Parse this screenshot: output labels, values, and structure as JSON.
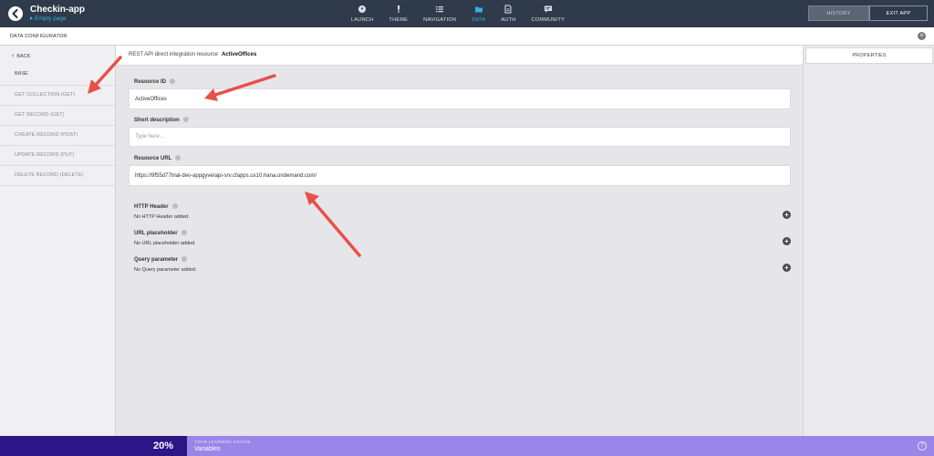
{
  "app": {
    "title": "Checkin-app",
    "subtitle": "Empty page"
  },
  "nav": {
    "items": [
      {
        "label": "LAUNCH",
        "icon": "rocket-icon"
      },
      {
        "label": "THEME",
        "icon": "brush-icon"
      },
      {
        "label": "NAVIGATION",
        "icon": "list-icon"
      },
      {
        "label": "DATA",
        "icon": "folder-icon",
        "active": true
      },
      {
        "label": "AUTH",
        "icon": "document-icon"
      },
      {
        "label": "COMMUNITY",
        "icon": "chat-icon"
      }
    ]
  },
  "header_buttons": {
    "history": "HISTORY",
    "exit": "EXIT APP"
  },
  "configurator": {
    "title": "DATA CONFIGURATOR",
    "close_icon": "close-icon"
  },
  "sidebar": {
    "back": "BACK",
    "base": "BASE",
    "items": [
      {
        "label": "GET COLLECTION (GET)"
      },
      {
        "label": "GET RECORD (GET)"
      },
      {
        "label": "CREATE RECORD (POST)"
      },
      {
        "label": "UPDATE RECORD (PUT)"
      },
      {
        "label": "DELETE RECORD (DELETE)"
      }
    ]
  },
  "main": {
    "header_prefix": "REST API direct integration resource",
    "resource_name": "ActiveOffices",
    "resource_id": {
      "label": "Resource ID",
      "value": "ActiveOffices"
    },
    "short_description": {
      "label": "Short description",
      "placeholder": "Type here..."
    },
    "resource_url": {
      "label": "Resource URL",
      "value": "https://9f55d77trial-dev-appgyverapi-srv.cfapps.us10.hana.ondemand.com/"
    },
    "http_header": {
      "label": "HTTP Header",
      "value": "No HTTP Header added."
    },
    "url_placeholder": {
      "label": "URL placeholder",
      "value": "No URL placeholder added."
    },
    "query_parameter": {
      "label": "Query parameter",
      "value": "No Query parameter added."
    }
  },
  "properties": {
    "title": "PROPERTIES"
  },
  "learning": {
    "percent": "20%",
    "label": "YOUR LEARNING STATUS",
    "value": "Variables",
    "progress": 0.2
  },
  "colors": {
    "topbar": "#2f3a4a",
    "accent": "#35b0e6",
    "progress_dark": "#2a1687",
    "progress_light": "#9a86e8",
    "annotation_arrow": "#e8504a"
  }
}
